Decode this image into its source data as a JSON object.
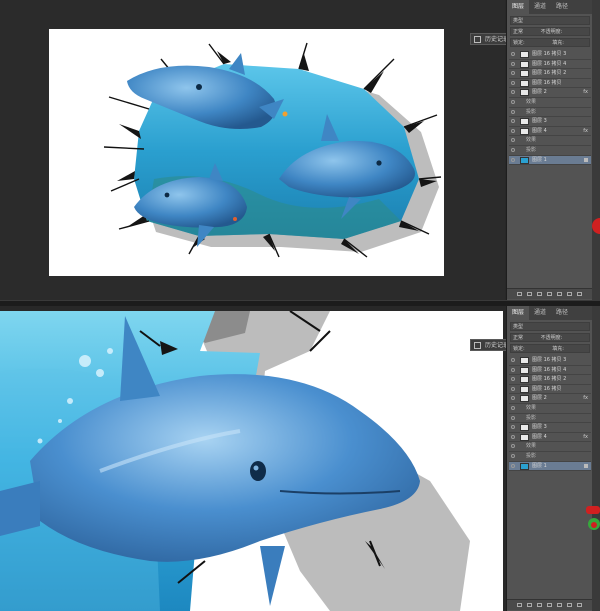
{
  "panel": {
    "tabs": [
      "图层",
      "通道",
      "路径"
    ],
    "kind_label": "类型",
    "blend_mode": "正常",
    "opacity_label": "不透明度:",
    "lock_label": "锁定:",
    "fill_label": "填充:",
    "layers": [
      {
        "name": "图层 16 拷贝 3",
        "type": "layer",
        "fx": false
      },
      {
        "name": "图层 16 拷贝 4",
        "type": "layer",
        "fx": false
      },
      {
        "name": "图层 16 拷贝 2",
        "type": "layer",
        "fx": false
      },
      {
        "name": "图层 16 拷贝",
        "type": "layer",
        "fx": false
      },
      {
        "name": "图层 2",
        "type": "layer",
        "fx": true
      },
      {
        "name": "效果",
        "type": "sub",
        "fx": false
      },
      {
        "name": "投影",
        "type": "sub",
        "fx": false
      },
      {
        "name": "图层 3",
        "type": "layer",
        "fx": false
      },
      {
        "name": "图层 4",
        "type": "layer",
        "fx": true
      },
      {
        "name": "效果",
        "type": "sub",
        "fx": false
      },
      {
        "name": "投影",
        "type": "sub",
        "fx": false
      },
      {
        "name": "图层 1",
        "type": "layer",
        "fx": false,
        "selected": true,
        "locked": true
      }
    ]
  },
  "history_button": {
    "label": "历史记录"
  },
  "colors": {
    "ui_dark": "#282828",
    "panel": "#535353",
    "selected_layer": "#6a7c93",
    "water": "#2aa0d0",
    "dolphin": "#3f86c4",
    "badge": "#d02020"
  }
}
